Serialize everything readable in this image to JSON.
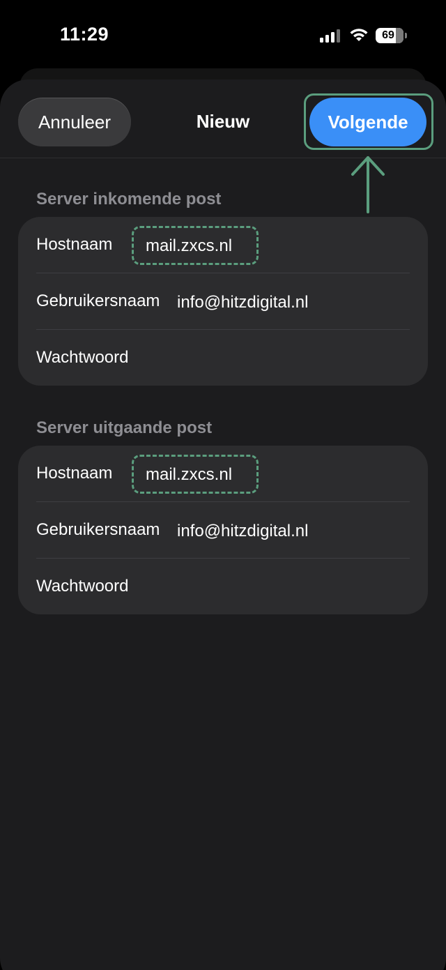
{
  "status_bar": {
    "time": "11:29",
    "battery": "69",
    "signal_icon": "cellular-signal-icon",
    "wifi_icon": "wifi-icon"
  },
  "nav": {
    "cancel_label": "Annuleer",
    "title": "Nieuw",
    "next_label": "Volgende"
  },
  "incoming": {
    "header": "Server inkomende post",
    "rows": [
      {
        "label": "Hostnaam",
        "value": "mail.zxcs.nl"
      },
      {
        "label": "Gebruikersnaam",
        "value": "info@hitzdigital.nl"
      },
      {
        "label": "Wachtwoord",
        "value": ""
      }
    ]
  },
  "outgoing": {
    "header": "Server uitgaande post",
    "rows": [
      {
        "label": "Hostnaam",
        "value": "mail.zxcs.nl"
      },
      {
        "label": "Gebruikersnaam",
        "value": "info@hitzdigital.nl"
      },
      {
        "label": "Wachtwoord",
        "value": ""
      }
    ]
  },
  "colors": {
    "accent": "#3a8ff7",
    "annotation": "#5b9e7e",
    "sheet_background": "#1c1c1e",
    "group_background": "#2c2c2e",
    "section_header": "#8e8e93"
  }
}
